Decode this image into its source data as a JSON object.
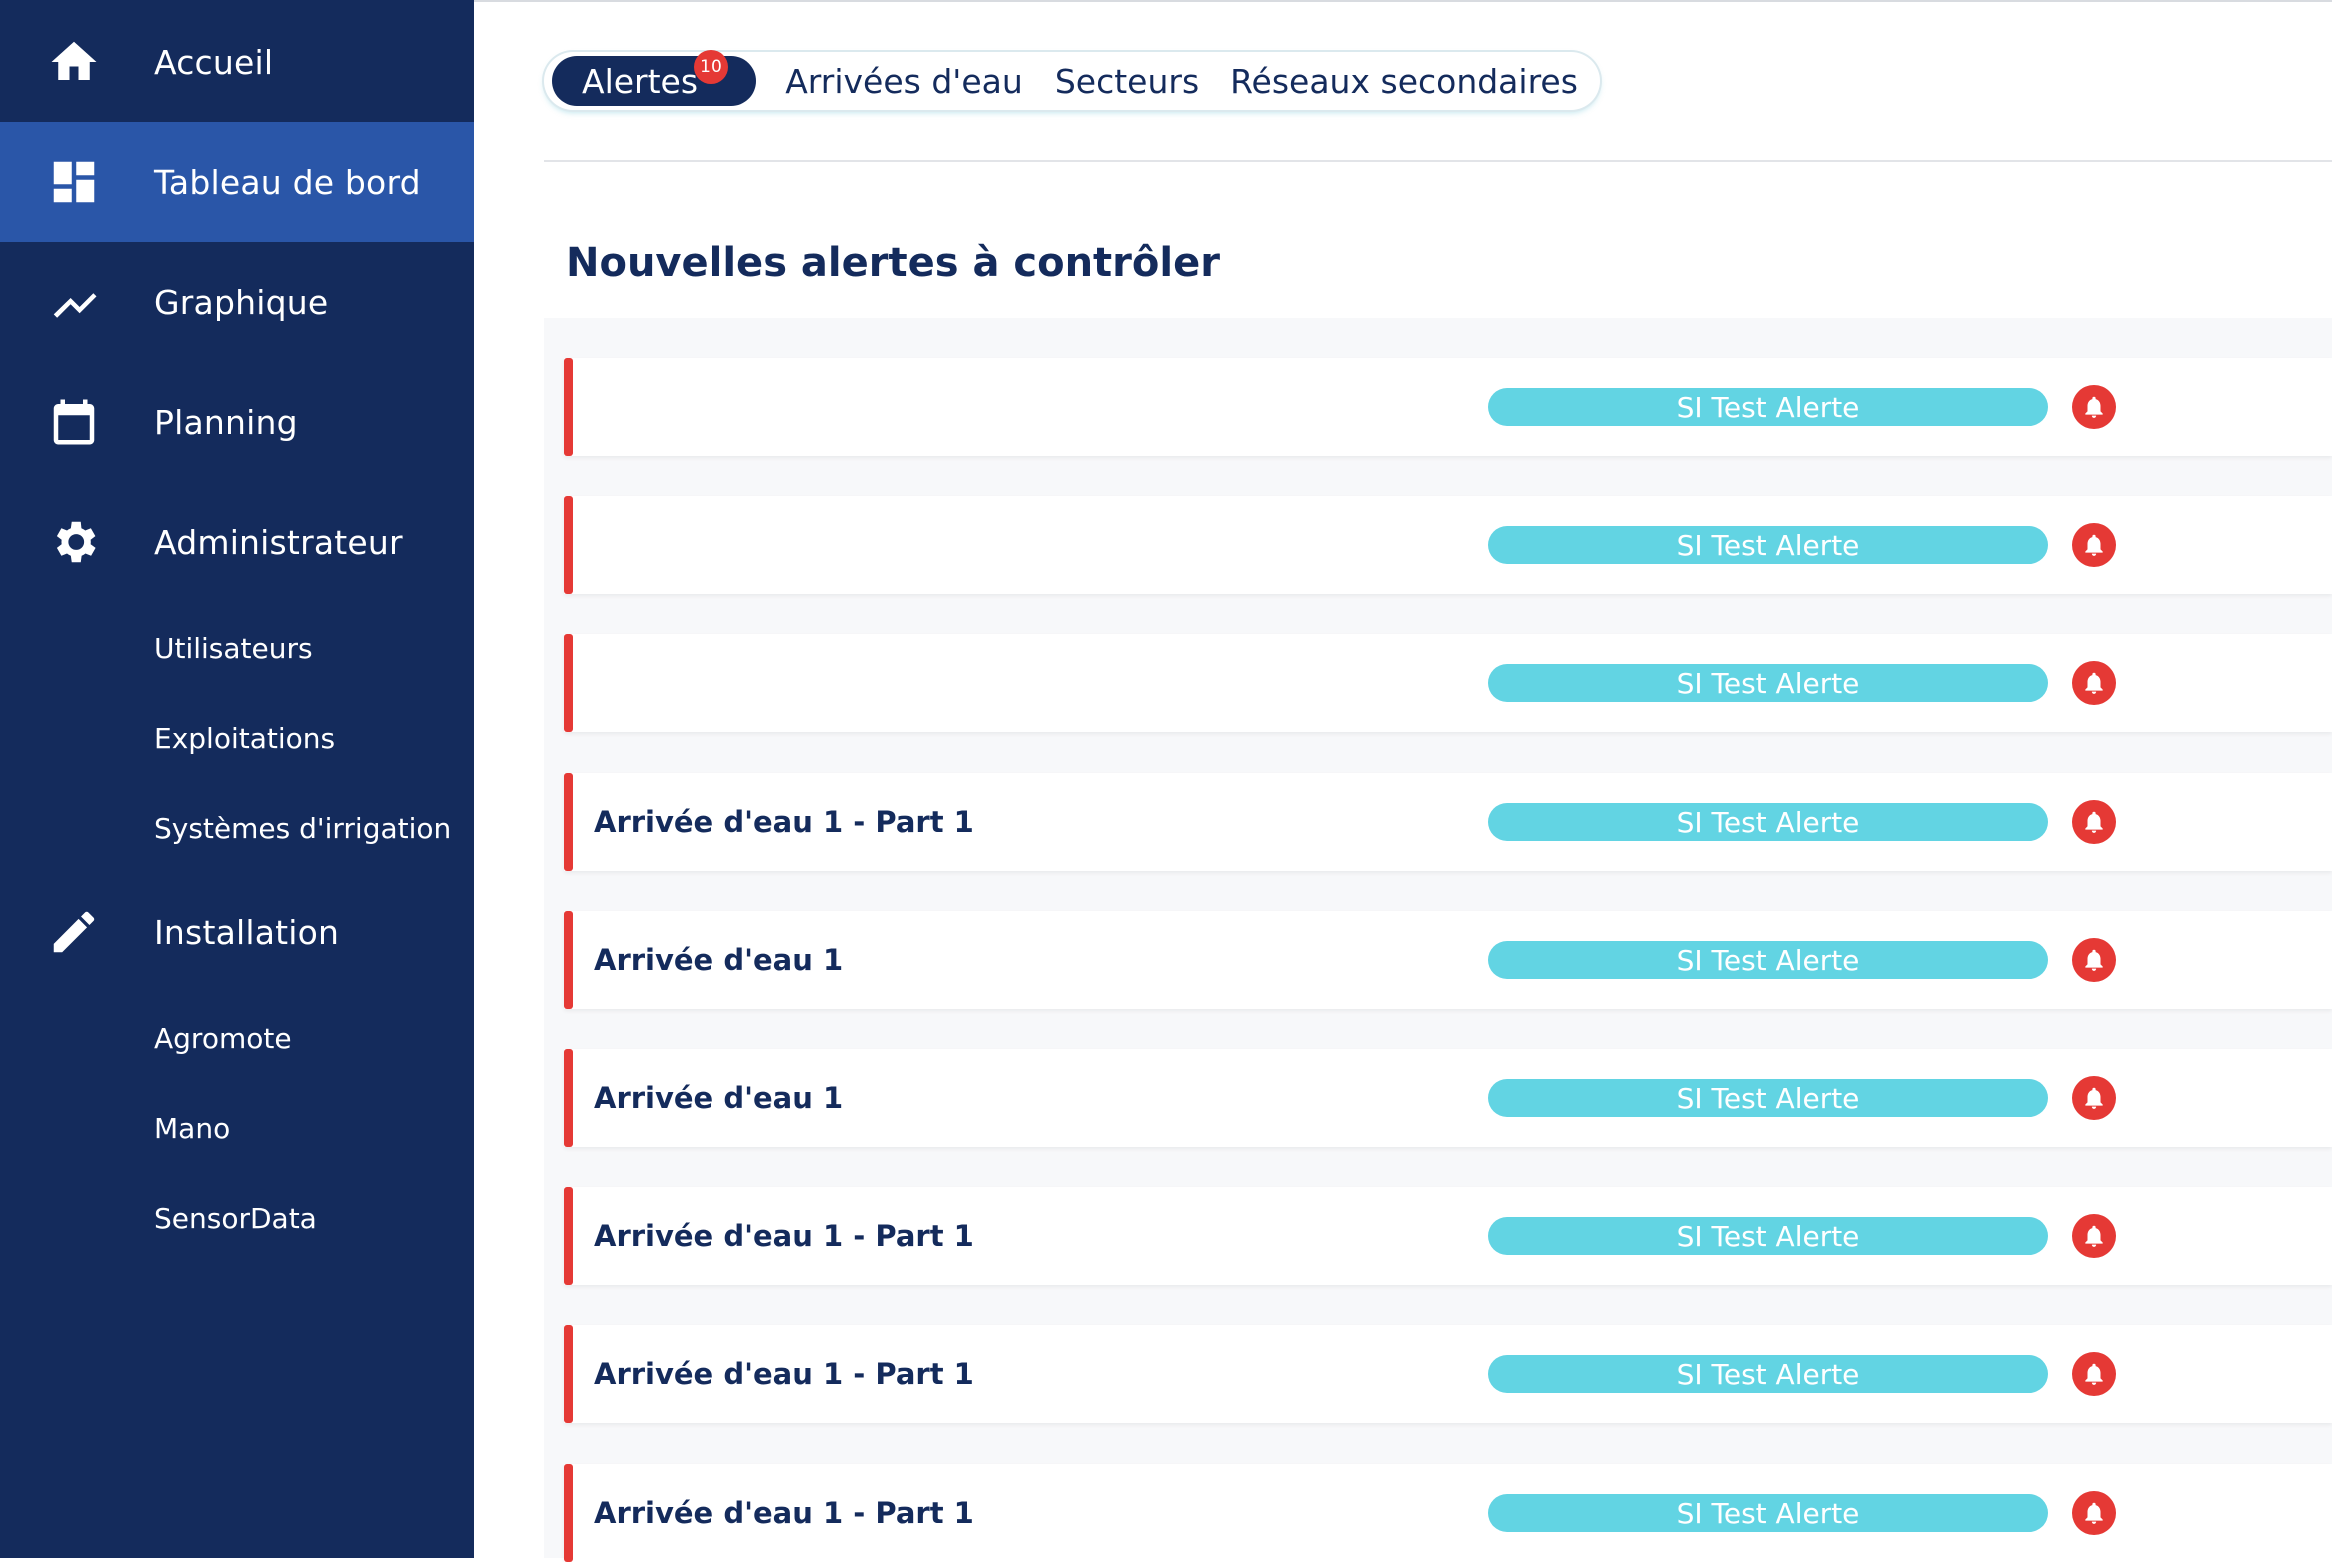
{
  "sidebar": {
    "main_items": [
      {
        "label": "Accueil",
        "icon": "home-icon"
      },
      {
        "label": "Tableau de bord",
        "icon": "dashboard-icon",
        "active": true
      },
      {
        "label": "Graphique",
        "icon": "trending-up-icon"
      },
      {
        "label": "Planning",
        "icon": "calendar-icon"
      },
      {
        "label": "Administrateur",
        "icon": "gear-icon"
      },
      {
        "label": "Installation",
        "icon": "pencil-icon"
      }
    ],
    "admin_sub": [
      "Utilisateurs",
      "Exploitations",
      "Systèmes d'irrigation"
    ],
    "install_sub": [
      "Agromote",
      "Mano",
      "SensorData"
    ]
  },
  "tabs": {
    "items": [
      "Alertes",
      "Arrivées d'eau",
      "Secteurs",
      "Réseaux secondaires"
    ],
    "active": "Alertes",
    "alert_count": "10"
  },
  "section": {
    "title": "Nouvelles alertes à contrôler"
  },
  "alerts": [
    {
      "name": "",
      "tag": "SI Test Alerte"
    },
    {
      "name": "",
      "tag": "SI Test Alerte"
    },
    {
      "name": "",
      "tag": "SI Test Alerte"
    },
    {
      "name": "Arrivée d'eau 1 - Part 1",
      "tag": "SI Test Alerte"
    },
    {
      "name": "Arrivée d'eau 1",
      "tag": "SI Test Alerte"
    },
    {
      "name": "Arrivée d'eau 1",
      "tag": "SI Test Alerte"
    },
    {
      "name": "Arrivée d'eau 1 - Part 1",
      "tag": "SI Test Alerte"
    },
    {
      "name": "Arrivée d'eau 1 - Part 1",
      "tag": "SI Test Alerte"
    },
    {
      "name": "Arrivée d'eau 1 - Part 1",
      "tag": "SI Test Alerte"
    }
  ],
  "colors": {
    "sidebar": "#142b5c",
    "sidebar_active": "#2a56a8",
    "alert_red": "#e53935",
    "tag_cyan": "#62d4e3"
  }
}
